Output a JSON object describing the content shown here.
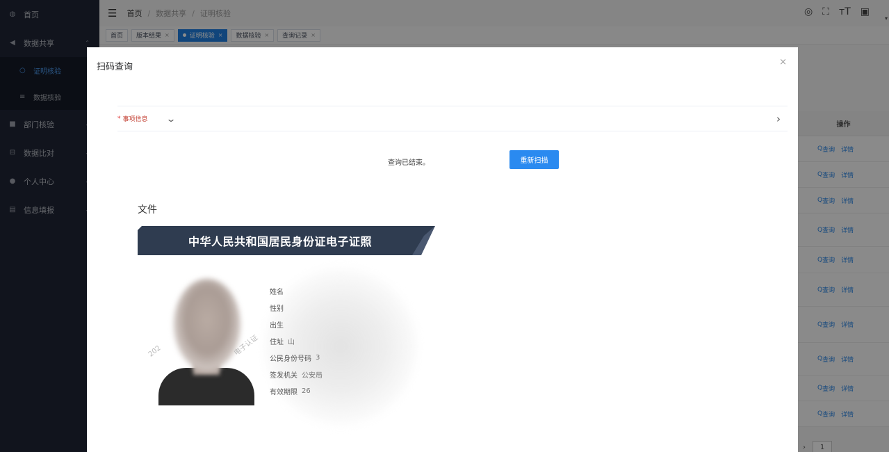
{
  "sidebar": {
    "items": [
      {
        "label": "首页",
        "icon": "dashboard-icon",
        "glyph": "◍"
      },
      {
        "label": "数据共享",
        "icon": "send-icon",
        "glyph": "◀",
        "expanded": true
      }
    ],
    "subitems": [
      {
        "label": "证明核验",
        "icon": "search-icon",
        "glyph": "○",
        "active": true
      },
      {
        "label": "数据核验",
        "icon": "filter-icon",
        "glyph": "≡",
        "active": false
      }
    ],
    "more": [
      {
        "label": "部门核验",
        "icon": "folder-icon",
        "glyph": "■"
      },
      {
        "label": "数据比对",
        "icon": "compare-icon",
        "glyph": "⊟"
      },
      {
        "label": "个人中心",
        "icon": "user-icon",
        "glyph": "●"
      },
      {
        "label": "信息填报",
        "icon": "form-icon",
        "glyph": "▤"
      }
    ]
  },
  "breadcrumb": {
    "home": "首页",
    "level2": "数据共享",
    "level3": "证明核验",
    "sep": "/"
  },
  "tabs": [
    {
      "label": "首页",
      "active": false,
      "closable": false
    },
    {
      "label": "版本结果",
      "active": false,
      "closable": true
    },
    {
      "label": "证明核验",
      "active": true,
      "closable": true
    },
    {
      "label": "数据核验",
      "active": false,
      "closable": true
    },
    {
      "label": "查询记录",
      "active": false,
      "closable": true
    }
  ],
  "table": {
    "ops_header": "操作",
    "query_label": "查询",
    "detail_label": "详情",
    "row_count": 10
  },
  "pagination": {
    "page": "1"
  },
  "dialog": {
    "title": "扫码查询",
    "close_glyph": "×",
    "collapse": {
      "required_mark": "*",
      "label": "事项信息"
    },
    "status_text": "查询已结束。",
    "rescan_button": "重新扫描",
    "section_label": "文件",
    "certificate": {
      "title": "中华人民共和国居民身份证电子证照",
      "banner_color": "#2f3c50",
      "fields": [
        {
          "label": "姓名",
          "value": ""
        },
        {
          "label": "性别",
          "value": ""
        },
        {
          "label": "出生",
          "value": ""
        },
        {
          "label": "住址",
          "value": "山"
        },
        {
          "label": "公民身份号码",
          "value": "3"
        },
        {
          "label": "签发机关",
          "value": "公安局"
        },
        {
          "label": "有效期限",
          "value": "26"
        }
      ],
      "stamp_year": "202",
      "stamp_text": "电子认证"
    }
  },
  "colors": {
    "sidebar_bg": "#1f2636",
    "accent": "#2a8af0",
    "required": "#e03535"
  }
}
